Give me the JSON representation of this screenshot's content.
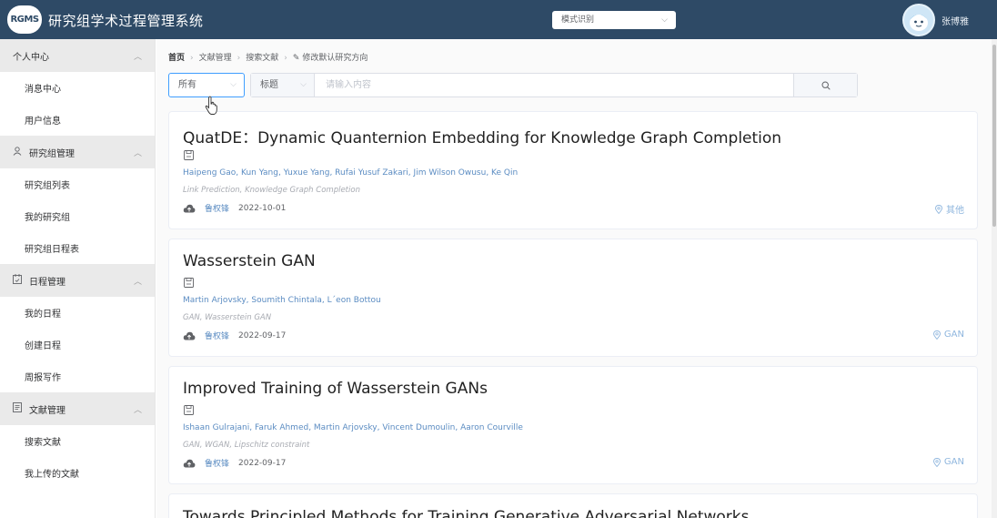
{
  "header": {
    "logo_text": "RGMS",
    "app_title": "研究组学术过程管理系统",
    "mode_select": "模式识别",
    "username": "张博雅"
  },
  "sidebar": {
    "groups": [
      {
        "label": "个人中心",
        "icon": "none",
        "items": [
          "消息中心",
          "用户信息"
        ]
      },
      {
        "label": "研究组管理",
        "icon": "user-icon",
        "items": [
          "研究组列表",
          "我的研究组",
          "研究组日程表"
        ]
      },
      {
        "label": "日程管理",
        "icon": "calendar-icon",
        "items": [
          "我的日程",
          "创建日程",
          "周报写作"
        ]
      },
      {
        "label": "文献管理",
        "icon": "document-icon",
        "items": [
          "搜索文献",
          "我上传的文献"
        ]
      }
    ]
  },
  "breadcrumb": [
    "首页",
    "文献管理",
    "搜索文献",
    "修改默认研究方向"
  ],
  "filters": {
    "scope": "所有",
    "field": "标题",
    "placeholder": "请输入内容"
  },
  "papers": [
    {
      "title": "QuatDE：Dynamic Quanternion Embedding for Knowledge Graph Completion",
      "authors": "Haipeng Gao, Kun Yang, Yuxue Yang, Rufai Yusuf Zakari, Jim Wilson Owusu, Ke Qin",
      "keywords": "Link Prediction, Knowledge Graph Completion",
      "uploader": "鲁权锋",
      "date": "2022-10-01",
      "direction": "其他"
    },
    {
      "title": "Wasserstein GAN",
      "authors": "Martin Arjovsky, Soumith Chintala, L´eon Bottou",
      "keywords": "GAN, Wasserstein GAN",
      "uploader": "鲁权锋",
      "date": "2022-09-17",
      "direction": "GAN"
    },
    {
      "title": "Improved Training of Wasserstein GANs",
      "authors": "Ishaan Gulrajani, Faruk Ahmed, Martin Arjovsky, Vincent Dumoulin, Aaron Courville",
      "keywords": "GAN, WGAN, Lipschitz constraint",
      "uploader": "鲁权锋",
      "date": "2022-09-17",
      "direction": "GAN"
    },
    {
      "title": "Towards Principled Methods for Training Generative Adversarial Networks"
    }
  ],
  "colors": {
    "header_bg": "#2e4a66",
    "link_blue": "#5b8cc2",
    "accent": "#409eff"
  }
}
